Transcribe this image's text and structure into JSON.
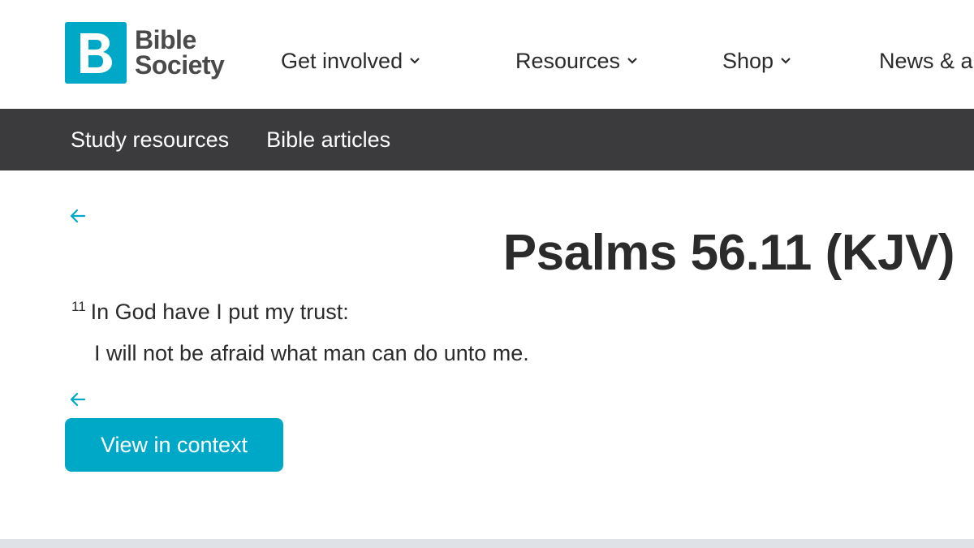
{
  "header": {
    "logo": {
      "icon": "bible-society-b-icon",
      "line1": "Bible",
      "line2": "Society",
      "brand_color": "#00a8c8"
    },
    "nav": [
      {
        "label": "Get involved",
        "icon": "chevron-down-icon"
      },
      {
        "label": "Resources",
        "icon": "chevron-down-icon"
      },
      {
        "label": "Shop",
        "icon": "chevron-down-icon"
      },
      {
        "label": "News & a"
      }
    ]
  },
  "subnav": {
    "background": "#3b3b3d",
    "items": [
      "Study resources",
      "Bible articles"
    ]
  },
  "content": {
    "back_icon": "arrow-left-icon",
    "title": "Psalms 56.11 (KJV)",
    "verse_number": "11",
    "verse_line1": "In God have I put my trust:",
    "verse_line2": "I will not be afraid what man can do unto me.",
    "button_label": "View in context",
    "accent_color": "#00a8c8"
  }
}
